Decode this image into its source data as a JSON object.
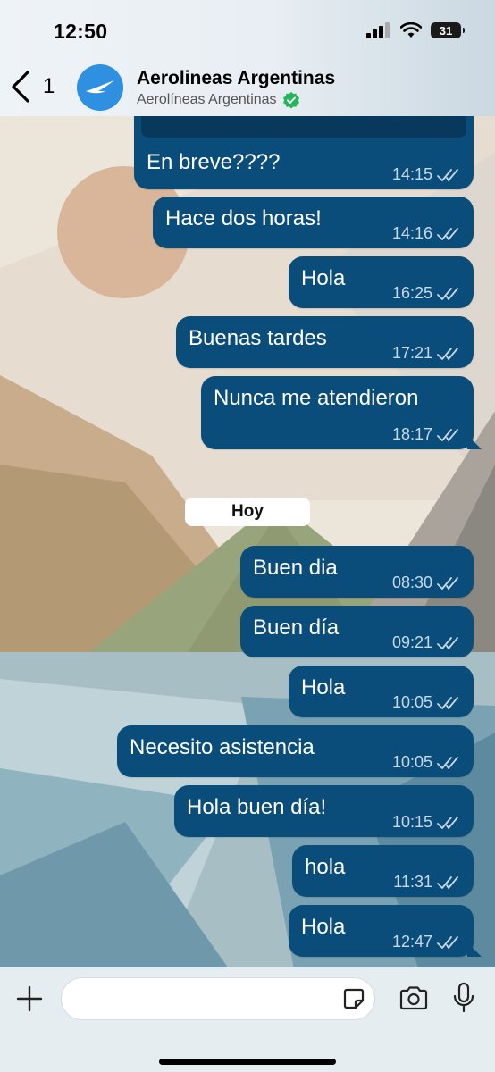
{
  "status_bar": {
    "time": "12:50",
    "battery": "31"
  },
  "header": {
    "back_count": "1",
    "title": "Aerolineas Argentinas",
    "subtitle": "Aerolíneas Argentinas"
  },
  "day_separator": "Hoy",
  "messages": [
    {
      "text": "En breve????",
      "time": "14:15"
    },
    {
      "text": "Hace dos horas!",
      "time": "14:16"
    },
    {
      "text": "Hola",
      "time": "16:25"
    },
    {
      "text": "Buenas tardes",
      "time": "17:21"
    },
    {
      "text": "Nunca me atendieron",
      "time": "18:17"
    },
    {
      "text": "Buen dia",
      "time": "08:30"
    },
    {
      "text": "Buen día",
      "time": "09:21"
    },
    {
      "text": "Hola",
      "time": "10:05"
    },
    {
      "text": "Necesito asistencia",
      "time": "10:05"
    },
    {
      "text": "Hola buen día!",
      "time": "10:15"
    },
    {
      "text": "hola",
      "time": "11:31"
    },
    {
      "text": "Hola",
      "time": "12:47"
    }
  ],
  "input": {
    "placeholder": "",
    "value": ""
  },
  "colors": {
    "bubble": "#0a4d7a",
    "avatar": "#2f8fe0",
    "verified": "#25b55a"
  }
}
